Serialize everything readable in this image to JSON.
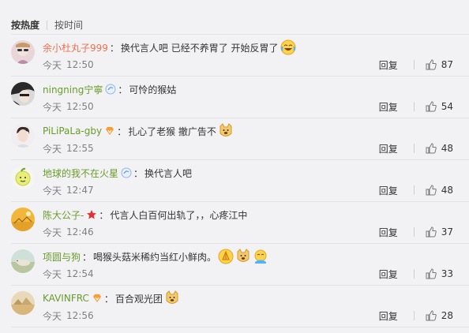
{
  "tabs": {
    "hot": "按热度",
    "time": "按时间"
  },
  "actions": {
    "reply_label": "回复"
  },
  "comments": [
    {
      "user": "余小杜丸子999",
      "text": "换代言人吧 已经不养胃了 开始反胃了",
      "date": "今天",
      "time": "12:50",
      "likes": "87"
    },
    {
      "user": "ningning宁寧",
      "text": "可怜的猴姑",
      "date": "今天",
      "time": "12:50",
      "likes": "54"
    },
    {
      "user": "PiLiPaLa-gby",
      "text": "扎心了老猴 撤广告不",
      "date": "今天",
      "time": "12:55",
      "likes": "48"
    },
    {
      "user": "地球的我不在火星",
      "text": "换代言人吧",
      "date": "今天",
      "time": "12:47",
      "likes": "48"
    },
    {
      "user": "陈大公子-",
      "text": "代言人白百何出轨了，，心疼江中",
      "date": "今天",
      "time": "12:46",
      "likes": "37"
    },
    {
      "user": "项圆与狗",
      "text": "喝猴头菇米稀约当红小鲜肉。",
      "date": "今天",
      "time": "12:54",
      "likes": "33"
    },
    {
      "user": "KAVINFRC",
      "text": "百合观光团",
      "date": "今天",
      "time": "12:56",
      "likes": "28"
    }
  ],
  "colors": {
    "username": "#eb7350",
    "username_green": "#6a9c2a",
    "username_gray": "#5a7e9e",
    "meta": "#808080",
    "background": "#f2f2f5"
  }
}
